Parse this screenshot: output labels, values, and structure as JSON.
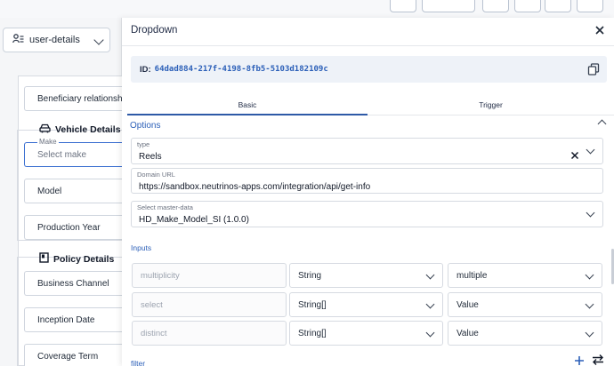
{
  "object_selector": {
    "label": "user-details",
    "icon": "user-list-icon"
  },
  "form": {
    "fields": [
      {
        "label": "Beneficiary relationship"
      },
      {
        "label": "Model"
      },
      {
        "label": "Production Year"
      },
      {
        "label": "Business Channel"
      },
      {
        "label": "Inception Date"
      },
      {
        "label": "Coverage Term"
      }
    ],
    "vehicle_section": {
      "title": "Vehicle Details",
      "icon": "car-icon"
    },
    "policy_section": {
      "title": "Policy Details",
      "icon": "document-icon"
    },
    "make_field": {
      "floating_label": "Make",
      "placeholder": "Select make"
    }
  },
  "drawer": {
    "title": "Dropdown",
    "id_label": "ID:",
    "id_value": "64dad884-217f-4198-8fb5-5103d182109c",
    "tabs": [
      {
        "label": "Basic",
        "active": true
      },
      {
        "label": "Trigger",
        "active": false
      }
    ],
    "options_title": "Options",
    "type": {
      "label": "type",
      "value": "Reels"
    },
    "domain_url": {
      "label": "Domain URL",
      "value": "https://sandbox.neutrinos-apps.com/integration/api/get-info"
    },
    "master_data": {
      "label": "Select master-data",
      "value": "HD_Make_Model_SI (1.0.0)"
    },
    "inputs_label": "Inputs",
    "inputs": [
      {
        "key": "multiplicity",
        "type": "String",
        "value": "multiple"
      },
      {
        "key": "select",
        "type": "String[]",
        "value": "Value"
      },
      {
        "key": "distinct",
        "type": "String[]",
        "value": "Value"
      }
    ],
    "filter_label": "filter"
  },
  "colors": {
    "accent": "#2b5fb8",
    "tab_underline": "#2e5aa7",
    "id_bg": "#eef2f8"
  }
}
